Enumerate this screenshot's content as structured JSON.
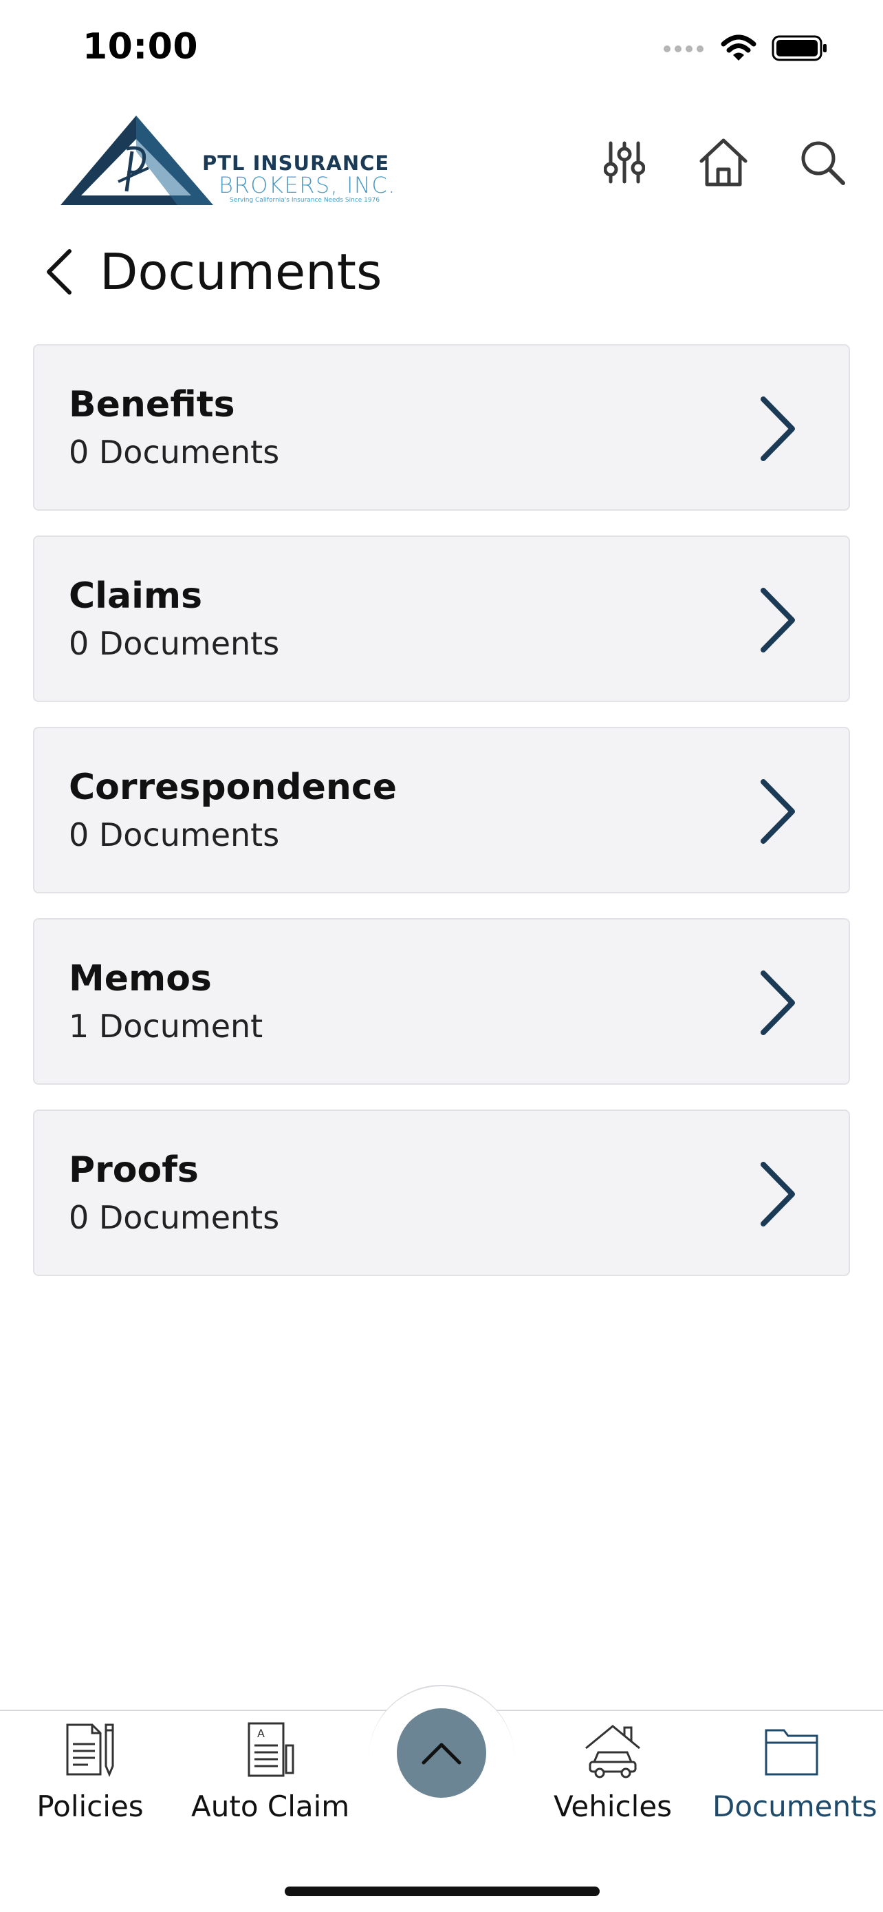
{
  "status_bar": {
    "time": "10:00",
    "icons": [
      "signal-icon",
      "wifi-icon",
      "battery-icon"
    ]
  },
  "header": {
    "logo": {
      "line1": "PTL INSURANCE",
      "line2": "BROKERS, INC.",
      "tagline": "Serving California's Insurance Needs Since 1976"
    },
    "icons": [
      "filter-sliders-icon",
      "home-icon",
      "search-icon"
    ]
  },
  "page": {
    "title": "Documents"
  },
  "documents": [
    {
      "title": "Benefits",
      "count": "0 Documents"
    },
    {
      "title": "Claims",
      "count": "0 Documents"
    },
    {
      "title": "Correspondence",
      "count": "0 Documents"
    },
    {
      "title": "Memos",
      "count": "1 Document"
    },
    {
      "title": "Proofs",
      "count": "0 Documents"
    }
  ],
  "tab_bar": {
    "tabs": [
      {
        "label": "Policies",
        "icon": "policy-document-icon"
      },
      {
        "label": "Auto Claim",
        "icon": "auto-claim-icon"
      },
      {
        "label": "Vehicles",
        "icon": "vehicle-garage-icon"
      },
      {
        "label": "Documents",
        "icon": "folder-icon"
      }
    ],
    "active": "Documents"
  },
  "colors": {
    "accent": "#1f4a6a",
    "chevron": "#1b3a56",
    "card_bg": "#f3f3f5",
    "fab": "#6b8595",
    "logo_dark": "#1b3a56",
    "logo_light": "#4a9ac5"
  }
}
